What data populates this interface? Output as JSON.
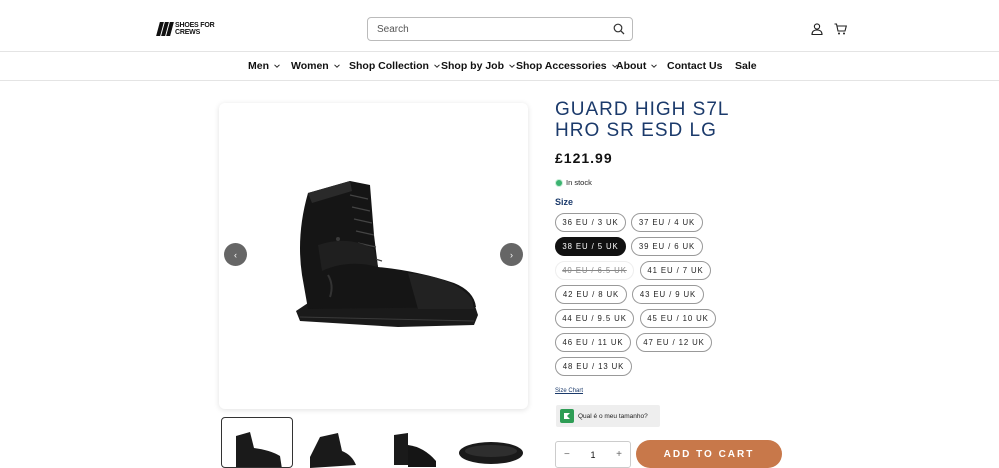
{
  "header": {
    "logo_line1": "SHOES FOR",
    "logo_line2": "CREWS",
    "search_placeholder": "Search"
  },
  "nav": {
    "items": [
      {
        "label": "Men",
        "dropdown": true
      },
      {
        "label": "Women",
        "dropdown": true
      },
      {
        "label": "Shop Collection",
        "dropdown": true
      },
      {
        "label": "Shop by Job",
        "dropdown": true
      },
      {
        "label": "Shop Accessories",
        "dropdown": true
      },
      {
        "label": "About",
        "dropdown": true
      },
      {
        "label": "Contact Us",
        "dropdown": false
      },
      {
        "label": "Sale",
        "dropdown": false
      }
    ]
  },
  "gallery": {
    "prev_label": "‹",
    "next_label": "›"
  },
  "product": {
    "title_line1": "GUARD HIGH S7L",
    "title_line2": "HRO SR ESD LG",
    "price": "£121.99",
    "stock": "In stock",
    "size_label": "Size",
    "sizes": [
      {
        "label": "36 EU / 3 UK",
        "state": "available"
      },
      {
        "label": "37 EU / 4 UK",
        "state": "available"
      },
      {
        "label": "38 EU / 5 UK",
        "state": "selected"
      },
      {
        "label": "39 EU / 6 UK",
        "state": "available"
      },
      {
        "label": "40 EU / 6.5 UK",
        "state": "unavailable"
      },
      {
        "label": "41 EU / 7 UK",
        "state": "available"
      },
      {
        "label": "42 EU / 8 UK",
        "state": "available"
      },
      {
        "label": "43 EU / 9 UK",
        "state": "available"
      },
      {
        "label": "44 EU / 9.5 UK",
        "state": "available"
      },
      {
        "label": "45 EU / 10 UK",
        "state": "available"
      },
      {
        "label": "46 EU / 11 UK",
        "state": "available"
      },
      {
        "label": "47 EU / 12 UK",
        "state": "available"
      },
      {
        "label": "48 EU / 13 UK",
        "state": "available"
      }
    ],
    "size_chart": "Size Chart",
    "whatsize": "Qual é o meu tamanho?",
    "quantity": "1",
    "minus": "−",
    "plus": "+",
    "add_to_cart": "ADD TO CART"
  },
  "colors": {
    "title": "#1b3a6b",
    "add_to_cart": "#c8784a",
    "in_stock": "#3cb371"
  }
}
